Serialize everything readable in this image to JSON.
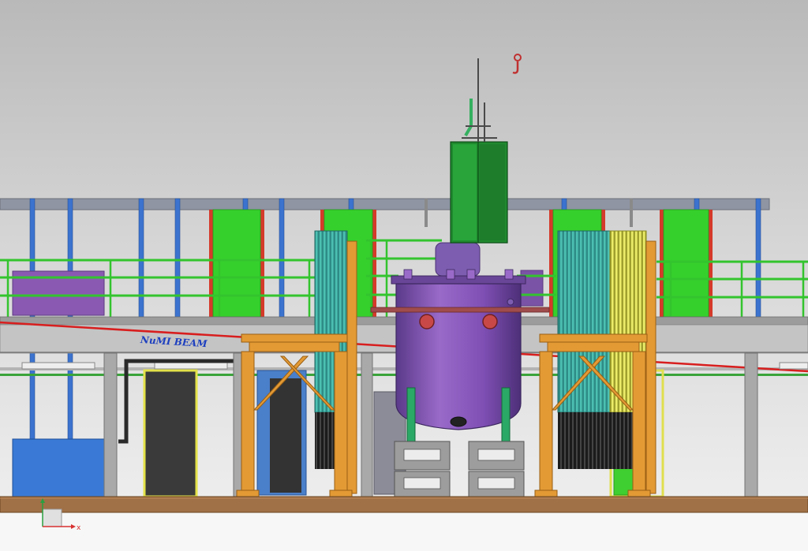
{
  "labels": {
    "beam_label": "NuMI BEAM"
  },
  "axis_triad": {
    "x_label": "x"
  },
  "colors": {
    "sky_top": "#bcbcbc",
    "sky_bottom": "#f0f0f0",
    "floor": "#a07046",
    "steel_gray": "#8e8e8e",
    "railing_green": "#37c233",
    "panel_green": "#34d12d",
    "dark_green": "#1d8a2b",
    "teal": "#3aa49a",
    "yellow": "#e1e05a",
    "orange": "#e39a35",
    "purple": "#8a58b6",
    "blue": "#3873d2",
    "red_line": "#d81e1e",
    "beam_label_color": "#1d3fbf"
  }
}
